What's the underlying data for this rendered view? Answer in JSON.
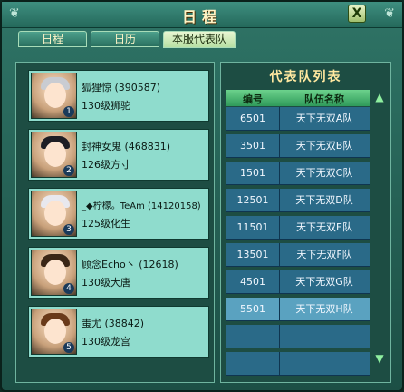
{
  "window": {
    "title": "日程",
    "close_label": "X"
  },
  "tabs": [
    {
      "label": "日程",
      "active": false
    },
    {
      "label": "日历",
      "active": false
    },
    {
      "label": "本服代表队",
      "active": true
    }
  ],
  "players": [
    {
      "name": "狐狸惊 (390587)",
      "level": "130级狮驼",
      "rank": "1",
      "hair": "#c9ccd2"
    },
    {
      "name": "封神女鬼 (468831)",
      "level": "126级方寸",
      "rank": "2",
      "hair": "#1e1e24"
    },
    {
      "name": "_◆柠檬。TeAm (14120158)",
      "level": "125级化生",
      "rank": "3",
      "hair": "#e8e8ee"
    },
    {
      "name": "顾念Echo丶 (12618)",
      "level": "130级大唐",
      "rank": "4",
      "hair": "#3a2616"
    },
    {
      "name": "蚩尤 (38842)",
      "level": "130级龙宫",
      "rank": "5",
      "hair": "#6a3a1a"
    }
  ],
  "team_list": {
    "title": "代表队列表",
    "headers": {
      "id": "编号",
      "name": "队伍名称"
    },
    "rows": [
      {
        "id": "6501",
        "name": "天下无双A队"
      },
      {
        "id": "3501",
        "name": "天下无双B队"
      },
      {
        "id": "1501",
        "name": "天下无双C队"
      },
      {
        "id": "12501",
        "name": "天下无双D队"
      },
      {
        "id": "11501",
        "name": "天下无双E队"
      },
      {
        "id": "13501",
        "name": "天下无双F队"
      },
      {
        "id": "4501",
        "name": "天下无双G队"
      },
      {
        "id": "5501",
        "name": "天下无双H队"
      }
    ],
    "selected_id": "5501"
  }
}
